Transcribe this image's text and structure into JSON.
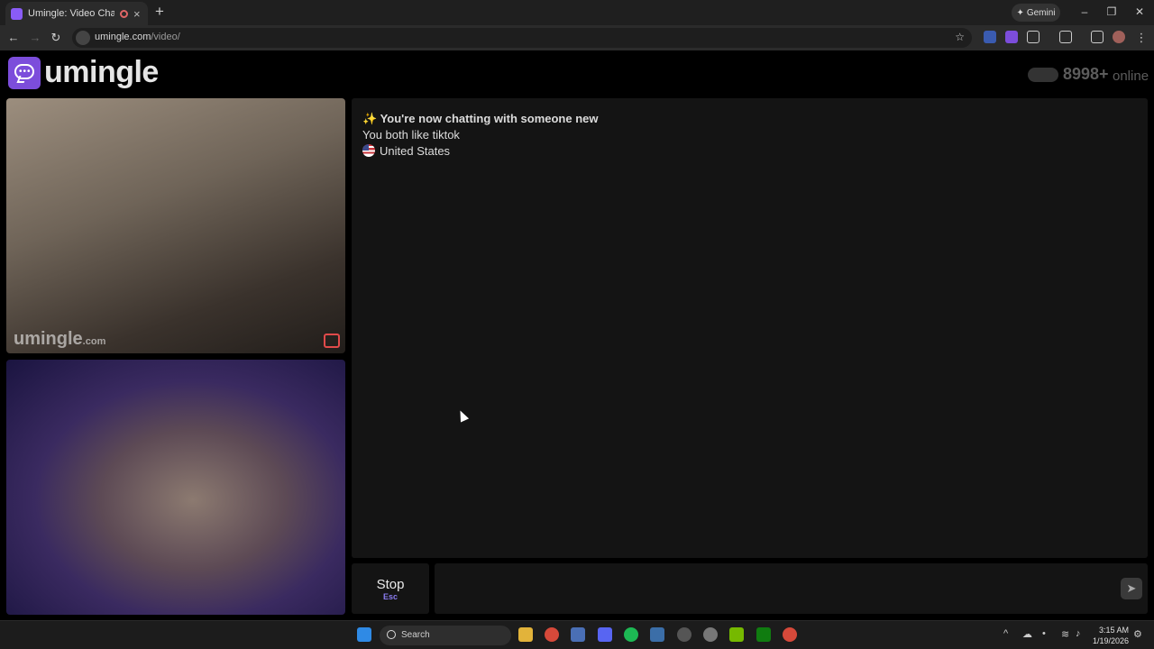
{
  "browser": {
    "tab_title": "Umingle: Video Chat with S",
    "tab_close": "×",
    "new_tab": "+",
    "gemini_label": "Gemini",
    "url_domain": "umingle.com",
    "url_path": "/video/"
  },
  "site": {
    "logo_text": "umingle",
    "online_count": "8998+",
    "online_label": "online"
  },
  "video": {
    "watermark": "umingle",
    "watermark_suffix": ".com"
  },
  "chat": {
    "status_line": "✨ You're now chatting with someone new",
    "interest_line": "You both like tiktok",
    "country": "United States"
  },
  "controls": {
    "stop_label": "Stop",
    "stop_key": "Esc",
    "send_icon": "➤"
  },
  "taskbar": {
    "search_label": "Search",
    "time": "3:15 AM",
    "date": "1/19/2026"
  },
  "colors": {
    "brand": "#7c4ddb",
    "background": "#000000",
    "panel": "#141414",
    "accent_key": "#8a7cf0"
  }
}
